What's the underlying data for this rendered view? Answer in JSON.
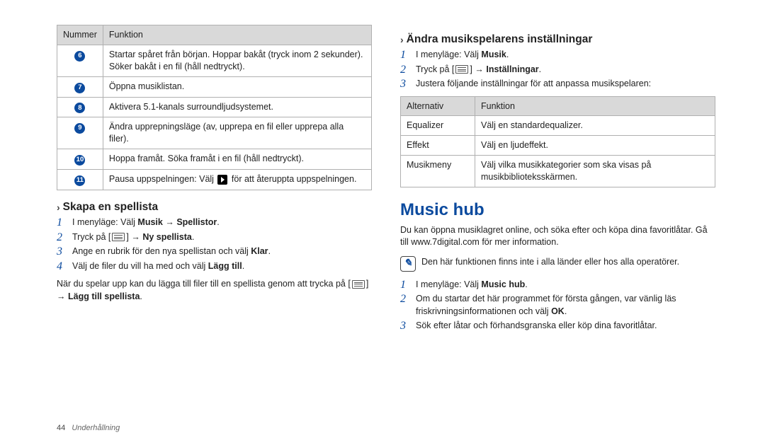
{
  "left": {
    "table": {
      "headers": [
        "Nummer",
        "Funktion"
      ],
      "rows": [
        {
          "num": "6",
          "text": "Startar spåret från början. Hoppar bakåt (tryck inom 2 sekunder). Söker bakåt i en fil (håll nedtryckt)."
        },
        {
          "num": "7",
          "text": "Öppna musiklistan."
        },
        {
          "num": "8",
          "text": "Aktivera 5.1-kanals surroundljudsystemet."
        },
        {
          "num": "9",
          "text": "Ändra upprepningsläge (av, upprepa en fil eller upprepa alla filer)."
        },
        {
          "num": "10",
          "text": "Hoppa framåt. Söka framåt i en fil (håll nedtryckt)."
        },
        {
          "num": "11",
          "pre": "Pausa uppspelningen: Välj ",
          "post": " för att återuppta uppspelningen."
        }
      ]
    },
    "subhead1": "Skapa en spellista",
    "steps1": {
      "s1_pre": "I menyläge: Välj ",
      "s1_b1": "Musik",
      "s1_mid": " → ",
      "s1_b2": "Spellistor",
      "s1_post": ".",
      "s2_pre": "Tryck på [",
      "s2_mid": "] → ",
      "s2_b": "Ny spellista",
      "s2_post": ".",
      "s3_pre": "Ange en rubrik för den nya spellistan och välj ",
      "s3_b": "Klar",
      "s3_post": ".",
      "s4_pre": "Välj de filer du vill ha med och välj ",
      "s4_b": "Lägg till",
      "s4_post": "."
    },
    "para1_pre": "När du spelar upp kan du lägga till filer till en spellista genom att trycka på [",
    "para1_mid": "] → ",
    "para1_b": "Lägg till spellista",
    "para1_post": "."
  },
  "right": {
    "subhead1": "Ändra musikspelarens inställningar",
    "steps1": {
      "s1_pre": "I menyläge: Välj ",
      "s1_b": "Musik",
      "s1_post": ".",
      "s2_pre": "Tryck på [",
      "s2_mid": "] → ",
      "s2_b": "Inställningar",
      "s2_post": ".",
      "s3": "Justera följande inställningar för att anpassa musikspelaren:"
    },
    "table": {
      "headers": [
        "Alternativ",
        "Funktion"
      ],
      "rows": [
        {
          "a": "Equalizer",
          "f": "Välj en standardequalizer."
        },
        {
          "a": "Effekt",
          "f": "Välj en ljudeffekt."
        },
        {
          "a": "Musikmeny",
          "f": "Välj vilka musikkategorier som ska visas på musikbiblioteksskärmen."
        }
      ]
    },
    "bigtitle": "Music hub",
    "para1": "Du kan öppna musiklagret online, och söka efter och köpa dina favoritlåtar. Gå till www.7digital.com för mer information.",
    "note": "Den här funktionen finns inte i alla länder eller hos alla operatörer.",
    "steps2": {
      "s1_pre": "I menyläge: Välj ",
      "s1_b": "Music hub",
      "s1_post": ".",
      "s2_pre": "Om du startar det här programmet för första gången, var vänlig läs friskrivningsinformationen och välj ",
      "s2_b": "OK",
      "s2_post": ".",
      "s3": "Sök efter låtar och förhandsgranska eller köp dina favoritlåtar."
    }
  },
  "footer": {
    "page": "44",
    "section": "Underhållning"
  }
}
